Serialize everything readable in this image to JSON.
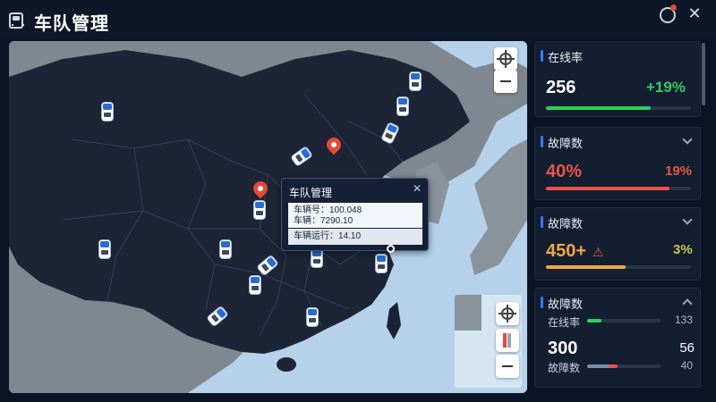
{
  "app": {
    "title": "车队管理"
  },
  "map": {
    "popup": {
      "title": "车队管理",
      "rows": [
        "车辆号：100.048",
        "车辆：7290.10",
        "车辆运行：14.10"
      ]
    },
    "controls": {
      "zoom_out": "−"
    }
  },
  "cards": [
    {
      "title": "在线率",
      "value": "256",
      "delta": "+19%",
      "delta_color": "#2fcf5a",
      "bar_color": "#2fcf5a",
      "progress": 0.72
    },
    {
      "title": "故障数",
      "value": "40%",
      "value_color": "#e9554a",
      "delta": "19%",
      "delta_color": "#e9554a",
      "bar_color": "#e9554a",
      "progress": 0.85
    },
    {
      "title": "故障数",
      "value": "450+",
      "value_color": "#f0a743",
      "delta": "3%",
      "delta_color": "#c2c94a",
      "bar_color": "#f0a743",
      "progress": 0.55
    },
    {
      "title": "故障数",
      "row1_label": "在线率",
      "row1_value": "133",
      "big_value": "300",
      "big_value_right": "56",
      "row2_label": "故障数",
      "row2_value": "40"
    }
  ]
}
